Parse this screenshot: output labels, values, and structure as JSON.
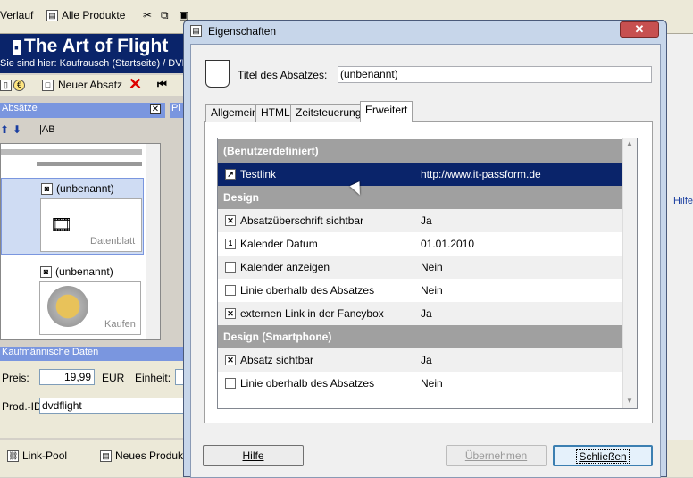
{
  "app": {
    "toolbar": {
      "verlauf": "Verlauf",
      "alle_produkte": "Alle Produkte"
    },
    "title": "The Art of Flight",
    "breadcrumb": "Sie sind hier: Kaufrausch (Startseite) / DVDs",
    "neuer_absatz": "Neuer Absatz",
    "panel_title": "Absätze",
    "panel_toolbar_ab": "AB",
    "side_label": "Pl",
    "cards": [
      {
        "title": "(unbenannt)",
        "caption": "Datenblatt"
      },
      {
        "title": "(unbenannt)",
        "caption": "Kaufen"
      }
    ],
    "kauf_header": "Kaufmännische Daten",
    "preis_label": "Preis:",
    "preis_value": "19,99",
    "currency": "EUR",
    "einheit_label": "Einheit:",
    "prod_id_label": "Prod.-ID:",
    "prod_id_value": "dvdflight",
    "bottom": {
      "link_pool": "Link-Pool",
      "neues_produkt": "Neues Produkt"
    },
    "right_link": "Hilfe"
  },
  "dialog": {
    "title": "Eigenschaften",
    "titel_label": "Titel des Absatzes:",
    "titel_value": "(unbenannt)",
    "tabs": [
      "Allgemein",
      "HTML",
      "Zeitsteuerung",
      "Erweitert"
    ],
    "active_tab": "Erweitert",
    "grid": {
      "cat_custom": "(Benutzerdefiniert)",
      "testlink_label": "Testlink",
      "testlink_value": "http://www.it-passform.de",
      "cat_design": "Design",
      "r1_label": "Absatzüberschrift sichtbar",
      "r1_value": "Ja",
      "r2_label": "Kalender Datum",
      "r2_value": "01.01.2010",
      "r3_label": "Kalender anzeigen",
      "r3_value": "Nein",
      "r4_label": "Linie oberhalb des Absatzes",
      "r4_value": "Nein",
      "r5_label": "externen Link in der Fancybox",
      "r5_value": "Ja",
      "cat_smart": "Design (Smartphone)",
      "r6_label": "Absatz sichtbar",
      "r6_value": "Ja",
      "r7_label": "Linie oberhalb des Absatzes",
      "r7_value": "Nein"
    },
    "buttons": {
      "hilfe": "Hilfe",
      "uebernehmen": "Übernehmen",
      "schliessen": "Schließen"
    }
  }
}
